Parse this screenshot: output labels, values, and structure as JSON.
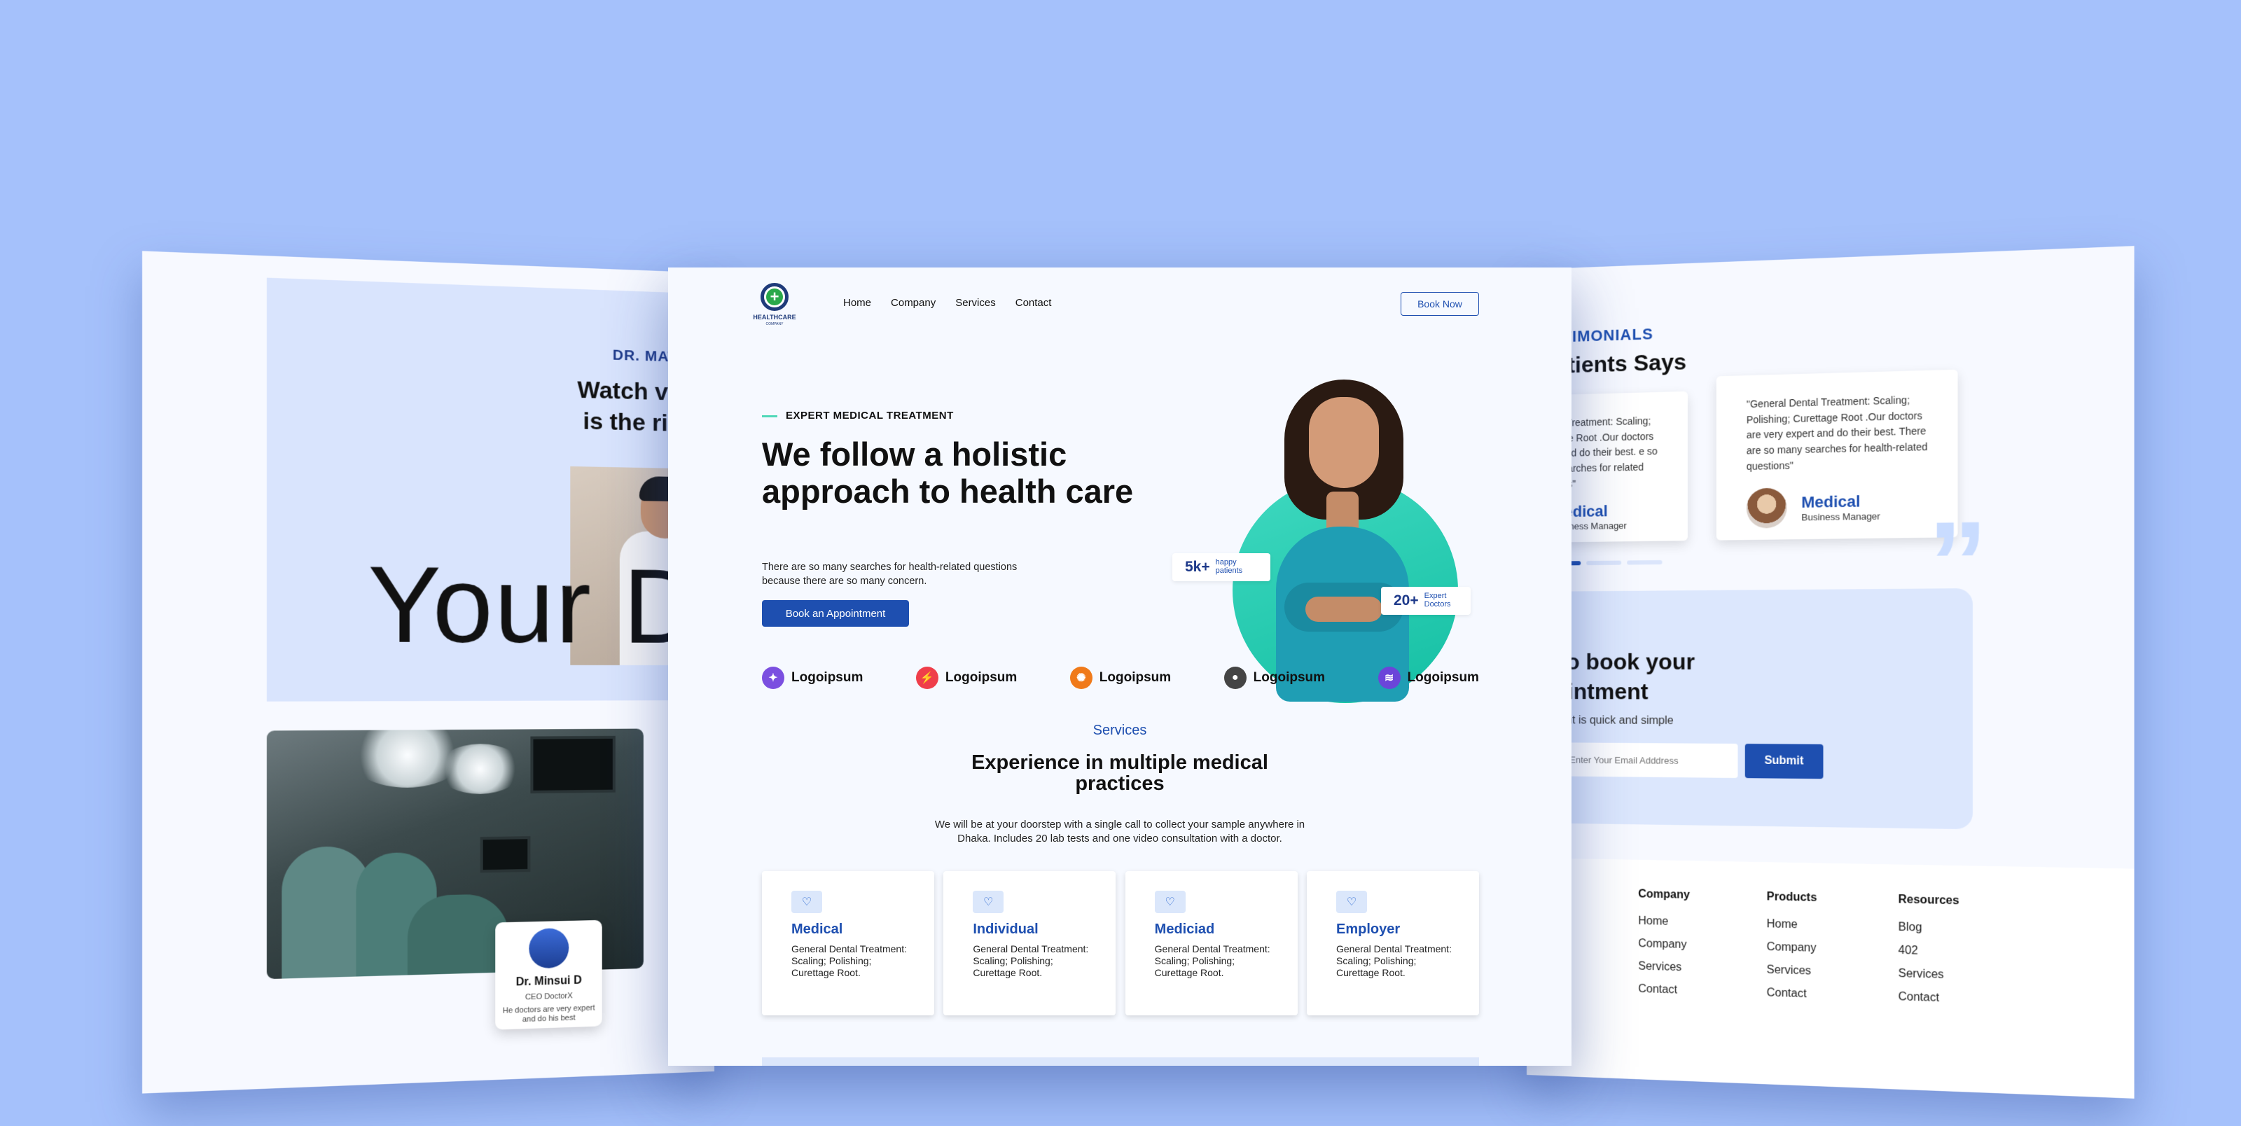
{
  "left_page": {
    "doctor_tag": "DR. MATHEW",
    "watch_line1": "Watch video t",
    "watch_line2": "is the right d",
    "big_text": "Your D",
    "card": {
      "name": "Dr. Minsui D",
      "role": "CEO DoctorX",
      "desc": "He doctors are very expert and do his best"
    }
  },
  "center": {
    "logo": {
      "name": "HEALTHCARE",
      "tagline": "COMPANY"
    },
    "nav": [
      "Home",
      "Company",
      "Services",
      "Contact"
    ],
    "book_now": "Book Now",
    "eyebrow": "EXPERT MEDICAL TREATMENT",
    "hero_title": "We follow a holistic approach to health care",
    "hero_sub": "There are so many searches for health-related questions because there are so many concern.",
    "appointment_button": "Book an Appointment",
    "stats": [
      {
        "num": "5k+",
        "label1": "happy",
        "label2": "patients"
      },
      {
        "num": "20+",
        "label1": "Expert",
        "label2": "Doctors"
      }
    ],
    "logos": [
      {
        "name": "Logoipsum",
        "color": "#7b4fe0",
        "icon": "✦"
      },
      {
        "name": "Logoipsum",
        "color": "#ef3e4a",
        "icon": "⚡"
      },
      {
        "name": "Logoipsum",
        "color": "#f07a1a",
        "icon": "✺"
      },
      {
        "name": "Logoipsum",
        "color": "#444444",
        "icon": "●"
      },
      {
        "name": "Logoipsum",
        "color": "#6b45d9",
        "icon": "≋"
      }
    ],
    "services_tag": "Services",
    "services_title_1": "Experience in multiple medical",
    "services_title_2": "practices",
    "services_sub_1": "We will be at your doorstep with a single call to collect your sample anywhere in",
    "services_sub_2": "Dhaka. Includes 20 lab tests and one video consultation with a doctor.",
    "services": [
      {
        "name": "Medical",
        "desc": "General Dental Treatment: Scaling; Polishing; Curettage Root."
      },
      {
        "name": "Individual",
        "desc": "General Dental Treatment: Scaling; Polishing; Curettage Root."
      },
      {
        "name": "Mediciad",
        "desc": "General Dental Treatment: Scaling; Polishing; Curettage Root."
      },
      {
        "name": "Employer",
        "desc": "General Dental Treatment: Scaling; Polishing; Curettage Root."
      }
    ]
  },
  "right_page": {
    "tag": "ESTIMONIALS",
    "title": "Patients Says",
    "testimonials": [
      {
        "quote": "l Dental Treatment: Scaling; Curettage Root .Our doctors expert and do their best. e so many searches for related questions\"",
        "name": "Medical",
        "role": "Business Manager"
      },
      {
        "quote": "\"General Dental Treatment: Scaling; Polishing; Curettage Root .Our doctors are very expert and do their best. There are so many searches for health-related questions\"",
        "name": "Medical",
        "role": "Business Manager"
      }
    ],
    "quote_mark": "”",
    "appt_title_1": "ch to book your",
    "appt_title_2": "ppointment",
    "appt_sub": "pointment is quick and simple",
    "email_placeholder": "Enter Your Email Adddress",
    "submit": "Submit",
    "footer": [
      {
        "heading": "Company",
        "items": [
          "Home",
          "Company",
          "Services",
          "Contact"
        ]
      },
      {
        "heading": "Products",
        "items": [
          "Home",
          "Company",
          "Services",
          "Contact"
        ]
      },
      {
        "heading": "Resources",
        "items": [
          "Blog",
          "402",
          "Services",
          "Contact"
        ]
      }
    ]
  }
}
